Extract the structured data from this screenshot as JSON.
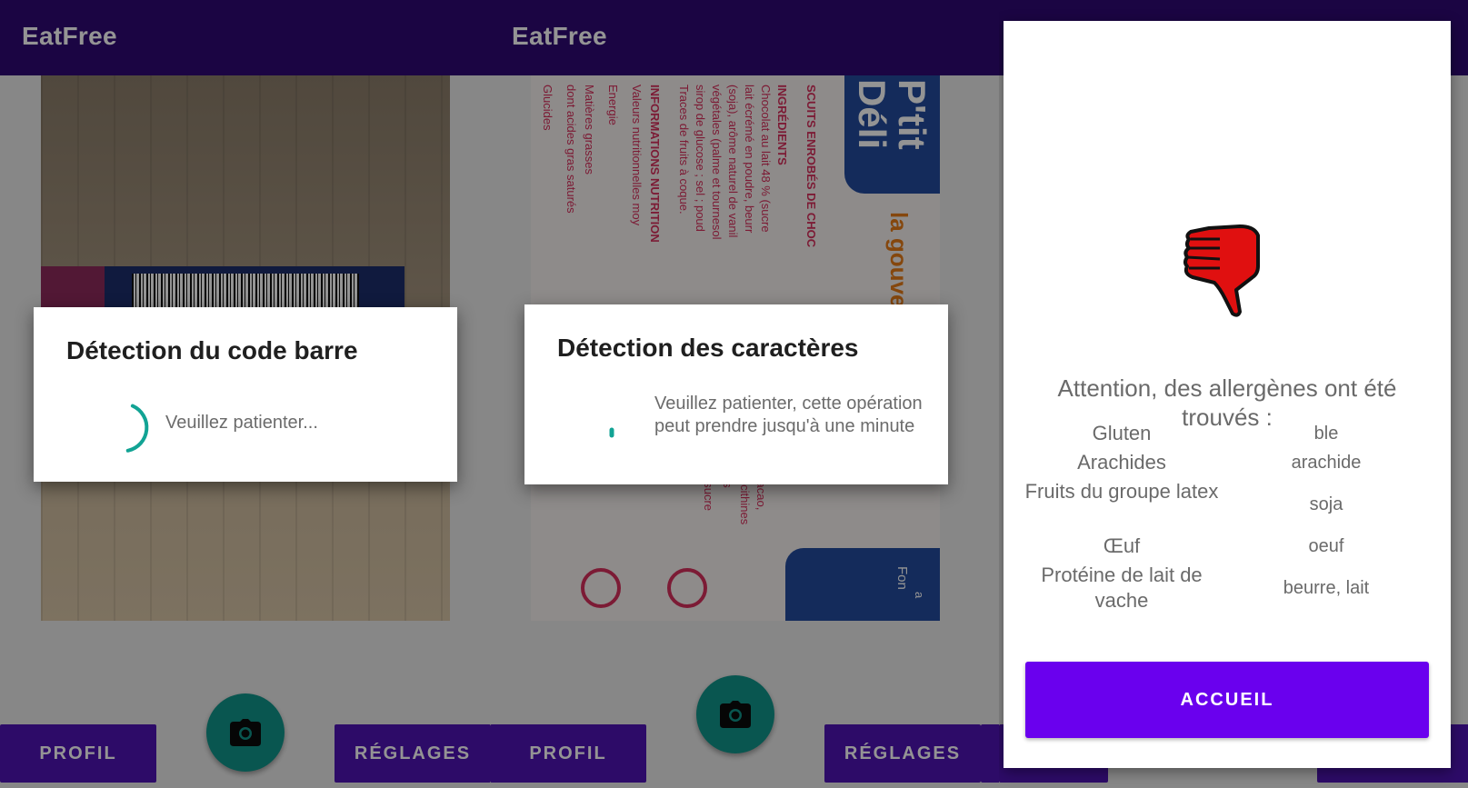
{
  "app": {
    "title": "EatFree"
  },
  "nav": {
    "profile_label": "PROFIL",
    "settings_label": "RÉGLAGES"
  },
  "barcode_dialog": {
    "title": "Détection du code barre",
    "message": "Veuillez patienter..."
  },
  "ocr_dialog": {
    "title": "Détection des caractères",
    "message": "Veuillez patienter, cette opération peut prendre jusqu'à une minute"
  },
  "result": {
    "icon": "thumbs-down-icon",
    "warning": "Attention, des allergènes ont été trouvés :",
    "allergens": [
      {
        "name": "Gluten",
        "trace": "ble"
      },
      {
        "name": "Arachides",
        "trace": "arachide"
      },
      {
        "name": "Fruits du groupe latex",
        "trace": "soja"
      },
      {
        "name": "Œuf",
        "trace": "oeuf"
      },
      {
        "name": "Protéine de lait de vache",
        "trace": "beurre, lait"
      }
    ],
    "home_label": "ACCUEIL"
  },
  "colors": {
    "appbar": "#2f0a74",
    "nav_button": "#4f13b4",
    "fab": "#11948a",
    "accent": "#6a00ee",
    "thumbs_down": "#e01010"
  },
  "package_text": {
    "col1": "SCUITS ENROBÉS DE CHOC",
    "col2": "INGRÉDIENTS",
    "col3": "Chocolat au lait 48 % (sucre",
    "col4": "lait écrémé en poudre, beurr",
    "col5": "(soja), arôme naturel de vanil",
    "col6": "végétales (palme et tournesol",
    "col7": "sirop de glucose ; sel ; poud",
    "col8": "Traces de fruits à coque.",
    "col9": "INFORMATIONS NUTRITION",
    "col10": "Valeurs nutritionnelles moy",
    "col11": "Energie",
    "col12": "Matières grasses",
    "col13": "dont acides gras saturés",
    "col14": "Glucides",
    "brand": "P'tit Déli",
    "side": "la gouverné avec",
    "right1": "cacao,",
    "right2": "lécithines",
    "right3": "; sucre",
    "right4": "es",
    "right5": "Fon",
    "right6": "a"
  }
}
